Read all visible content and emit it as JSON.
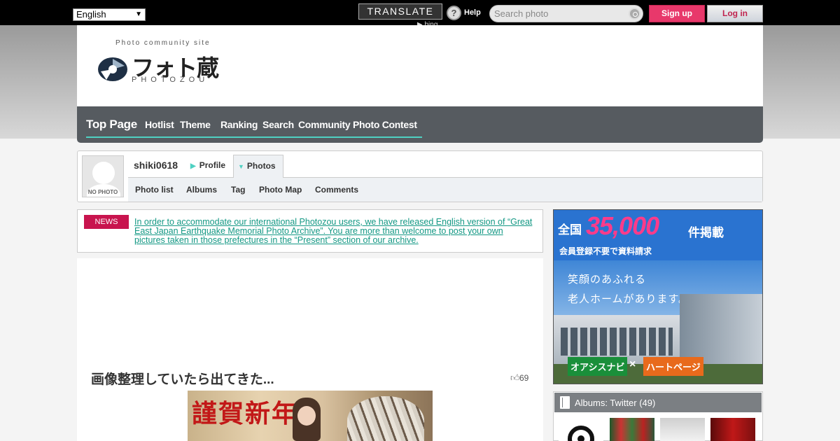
{
  "topbar": {
    "language": "English",
    "translate_label": "TRANSLATE",
    "bing_label": "bing",
    "help_label": "Help",
    "search_placeholder": "Search photo",
    "signup_label": "Sign up",
    "login_label": "Log in"
  },
  "logo": {
    "tagline": "Photo community site",
    "name_jp": "フォト蔵",
    "name_en": "PHOTOZOU"
  },
  "nav": {
    "items": [
      "Top Page",
      "Hotlist",
      "Theme",
      "Ranking",
      "Search",
      "Community",
      "Photo Contest"
    ]
  },
  "profile": {
    "avatar_text": "NO PHOTO",
    "username": "shiki0618",
    "tabs": [
      "Profile",
      "Photos"
    ],
    "sub_nav": [
      "Photo list",
      "Albums",
      "Tag",
      "Photo Map",
      "Comments"
    ]
  },
  "news": {
    "badge": "NEWS",
    "text": "In order to accommodate our international Photozou users, we have released English version of “Great East Japan Earthquake Memorial Photo Archive”. You are more than welcome to post your own pictures taken in those prefectures in the “Present” section of our archive."
  },
  "photo": {
    "title": "画像整理していたら出てきた...",
    "fav_count": "69",
    "image_text": "謹賀新年"
  },
  "ad": {
    "head": "全国",
    "number": "35,000",
    "tail": "件掲載",
    "sub": "会員登録不要で資料請求",
    "line1": "笑顔のあふれる",
    "line2": "老人ホームがあります。",
    "brand1": "オアシスナビ",
    "cross": "×",
    "brand2": "ハートページ"
  },
  "albums": {
    "title": "Albums: Twitter (49)"
  },
  "colors": {
    "accent_teal": "#4fd1c2",
    "signup_pink": "#e8386b",
    "nav_gray": "#565b60",
    "news_red": "#c8144e",
    "link_teal": "#139884"
  }
}
